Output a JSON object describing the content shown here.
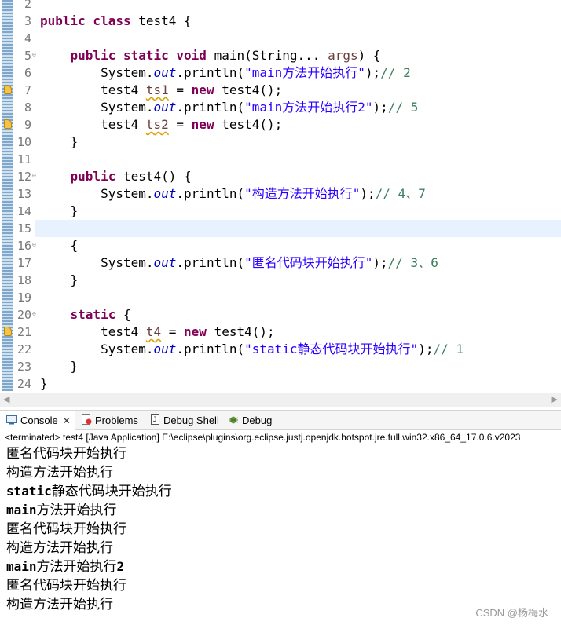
{
  "editor": {
    "lines": [
      {
        "n": "2",
        "tokens": []
      },
      {
        "n": "3",
        "tokens": [
          {
            "t": "public class ",
            "c": "kw"
          },
          {
            "t": "test4 {",
            "c": ""
          }
        ]
      },
      {
        "n": "4",
        "tokens": []
      },
      {
        "n": "5",
        "fold": true,
        "tokens": [
          {
            "t": "    "
          },
          {
            "t": "public static void ",
            "c": "kw"
          },
          {
            "t": "main(String... "
          },
          {
            "t": "args",
            "c": "lv"
          },
          {
            "t": ") {"
          }
        ]
      },
      {
        "n": "6",
        "tokens": [
          {
            "t": "        System."
          },
          {
            "t": "out",
            "c": "fi"
          },
          {
            "t": ".println("
          },
          {
            "t": "\"main方法开始执行\"",
            "c": "st"
          },
          {
            "t": ");"
          },
          {
            "t": "// 2",
            "c": "cm"
          }
        ]
      },
      {
        "n": "7",
        "warn": true,
        "tokens": [
          {
            "t": "        test4 "
          },
          {
            "t": "ts1",
            "c": "lv dep"
          },
          {
            "t": " = "
          },
          {
            "t": "new",
            "c": "kw"
          },
          {
            "t": " test4();"
          }
        ]
      },
      {
        "n": "8",
        "tokens": [
          {
            "t": "        System."
          },
          {
            "t": "out",
            "c": "fi"
          },
          {
            "t": ".println("
          },
          {
            "t": "\"main方法开始执行2\"",
            "c": "st"
          },
          {
            "t": ");"
          },
          {
            "t": "// 5",
            "c": "cm"
          }
        ]
      },
      {
        "n": "9",
        "warn": true,
        "tokens": [
          {
            "t": "        test4 "
          },
          {
            "t": "ts2",
            "c": "lv dep"
          },
          {
            "t": " = "
          },
          {
            "t": "new",
            "c": "kw"
          },
          {
            "t": " test4();"
          }
        ]
      },
      {
        "n": "10",
        "tokens": [
          {
            "t": "    }"
          }
        ]
      },
      {
        "n": "11",
        "tokens": []
      },
      {
        "n": "12",
        "fold": true,
        "tokens": [
          {
            "t": "    "
          },
          {
            "t": "public",
            "c": "kw"
          },
          {
            "t": " test4() {"
          }
        ]
      },
      {
        "n": "13",
        "tokens": [
          {
            "t": "        System."
          },
          {
            "t": "out",
            "c": "fi"
          },
          {
            "t": ".println("
          },
          {
            "t": "\"构造方法开始执行\"",
            "c": "st"
          },
          {
            "t": ");"
          },
          {
            "t": "// 4、7",
            "c": "cm"
          }
        ]
      },
      {
        "n": "14",
        "tokens": [
          {
            "t": "    }"
          }
        ]
      },
      {
        "n": "15",
        "highlight": true,
        "tokens": []
      },
      {
        "n": "16",
        "fold": true,
        "tokens": [
          {
            "t": "    {"
          }
        ]
      },
      {
        "n": "17",
        "tokens": [
          {
            "t": "        System."
          },
          {
            "t": "out",
            "c": "fi"
          },
          {
            "t": ".println("
          },
          {
            "t": "\"匿名代码块开始执行\"",
            "c": "st"
          },
          {
            "t": ");"
          },
          {
            "t": "// 3、6",
            "c": "cm"
          }
        ]
      },
      {
        "n": "18",
        "tokens": [
          {
            "t": "    }"
          }
        ]
      },
      {
        "n": "19",
        "tokens": []
      },
      {
        "n": "20",
        "fold": true,
        "tokens": [
          {
            "t": "    "
          },
          {
            "t": "static",
            "c": "kw"
          },
          {
            "t": " {"
          }
        ]
      },
      {
        "n": "21",
        "warn": true,
        "tokens": [
          {
            "t": "        test4 "
          },
          {
            "t": "t4",
            "c": "lv dep"
          },
          {
            "t": " = "
          },
          {
            "t": "new",
            "c": "kw"
          },
          {
            "t": " test4();"
          }
        ]
      },
      {
        "n": "22",
        "tokens": [
          {
            "t": "        System."
          },
          {
            "t": "out",
            "c": "fi"
          },
          {
            "t": ".println("
          },
          {
            "t": "\"static静态代码块开始执行\"",
            "c": "st"
          },
          {
            "t": ");"
          },
          {
            "t": "// 1",
            "c": "cm"
          }
        ]
      },
      {
        "n": "23",
        "tokens": [
          {
            "t": "    }"
          }
        ]
      },
      {
        "n": "24",
        "tokens": [
          {
            "t": "}"
          }
        ]
      }
    ]
  },
  "tabs": {
    "console": "Console",
    "console_close": "✕",
    "problems": "Problems",
    "debug_shell": "Debug Shell",
    "debug": "Debug"
  },
  "console": {
    "status": "<terminated> test4 [Java Application] E:\\eclipse\\plugins\\org.eclipse.justj.openjdk.hotspot.jre.full.win32.x86_64_17.0.6.v2023",
    "output": [
      {
        "text": "匿名代码块开始执行"
      },
      {
        "text": "构造方法开始执行"
      },
      {
        "ascii": "static",
        "text": "静态代码块开始执行"
      },
      {
        "ascii": "main",
        "text": "方法开始执行"
      },
      {
        "text": "匿名代码块开始执行"
      },
      {
        "text": "构造方法开始执行"
      },
      {
        "ascii": "main",
        "text": "方法开始执行",
        "ascii_tail": "2"
      },
      {
        "text": "匿名代码块开始执行"
      },
      {
        "text": "构造方法开始执行"
      }
    ]
  },
  "watermark": "CSDN @杨梅水",
  "colors": {
    "keyword": "#7f0055",
    "string": "#2a00ff",
    "comment": "#3f7f5f",
    "field": "#0000c0",
    "current_line": "#e8f2fe"
  },
  "icons": [
    "console-icon",
    "problems-icon",
    "debug-shell-icon",
    "debug-icon",
    "warning-icon",
    "fold-icon"
  ]
}
